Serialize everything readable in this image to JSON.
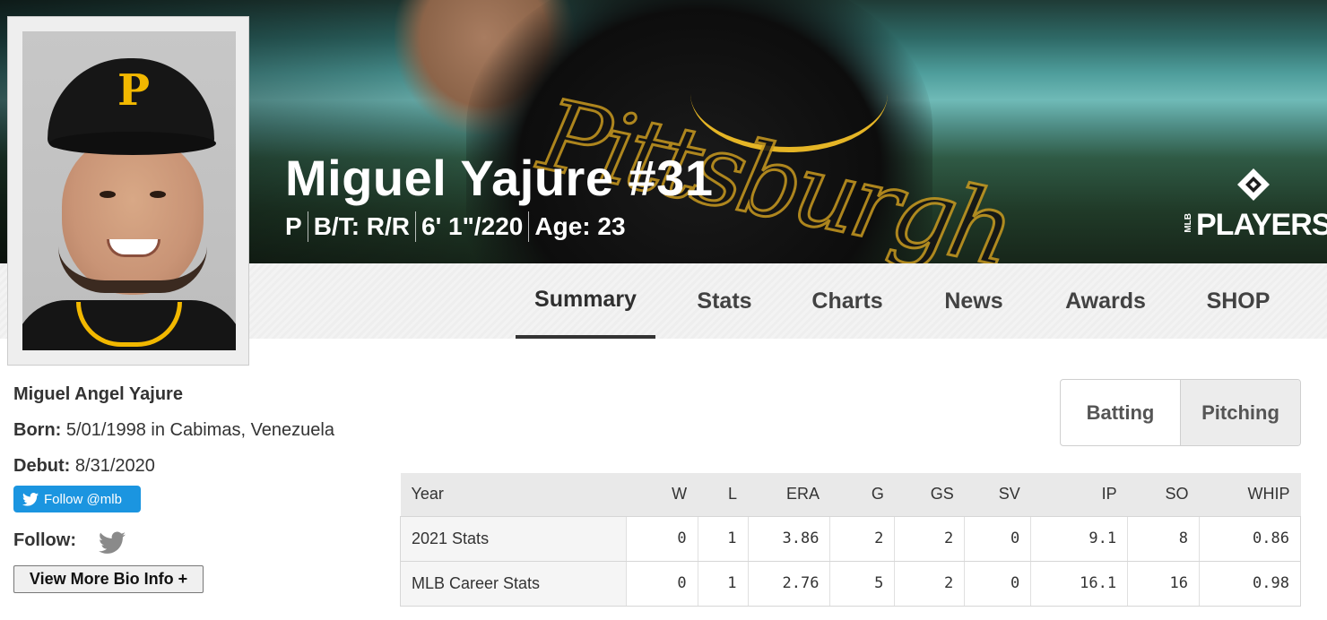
{
  "hero": {
    "title": "Miguel Yajure #31",
    "position": "P",
    "bats_throws": "B/T: R/R",
    "height_weight": "6' 1\"/220",
    "age": "Age: 23",
    "logo_text": "PLAYERS",
    "logo_prefix": "MLB"
  },
  "tabs": [
    {
      "label": "Summary",
      "active": true
    },
    {
      "label": "Stats"
    },
    {
      "label": "Charts"
    },
    {
      "label": "News"
    },
    {
      "label": "Awards"
    },
    {
      "label": "SHOP"
    }
  ],
  "bio": {
    "full_name": "Miguel Angel Yajure",
    "born_label": "Born:",
    "born_value": "5/01/1998 in Cabimas, Venezuela",
    "debut_label": "Debut:",
    "debut_value": "8/31/2020",
    "twitter_button": "Follow @mlb",
    "follow_label": "Follow:",
    "more_button": "View More Bio Info +"
  },
  "stat_toggle": {
    "options": [
      "Batting",
      "Pitching"
    ],
    "selected": "Pitching"
  },
  "stats_table": {
    "columns": [
      "Year",
      "W",
      "L",
      "ERA",
      "G",
      "GS",
      "SV",
      "IP",
      "SO",
      "WHIP"
    ],
    "rows": [
      [
        "2021 Stats",
        "0",
        "1",
        "3.86",
        "2",
        "2",
        "0",
        "9.1",
        "8",
        "0.86"
      ],
      [
        "MLB Career Stats",
        "0",
        "1",
        "2.76",
        "5",
        "2",
        "0",
        "16.1",
        "16",
        "0.98"
      ]
    ]
  },
  "colors": {
    "twitter_blue": "#1b95e0",
    "pirates_gold": "#f2b800"
  }
}
